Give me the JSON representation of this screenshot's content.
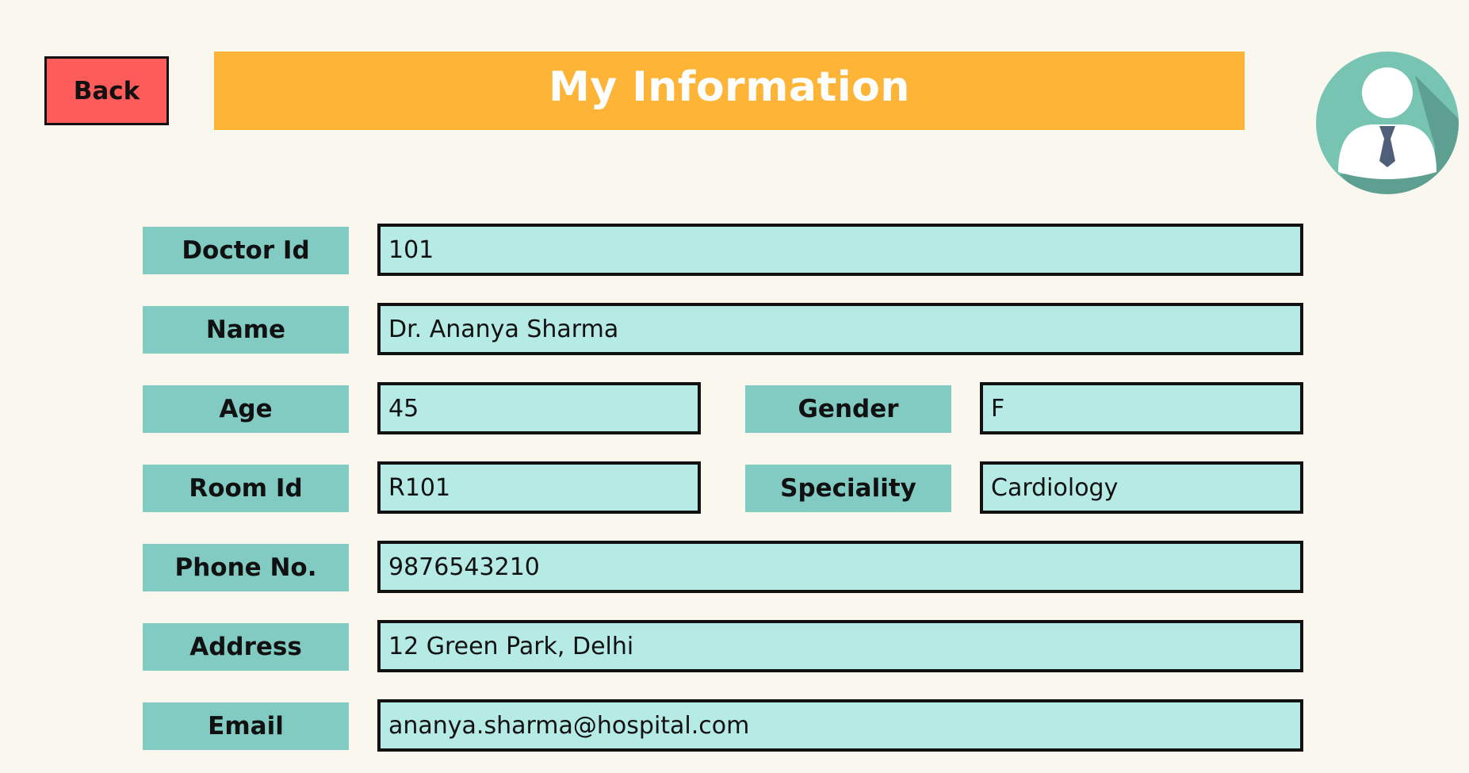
{
  "header": {
    "back_label": "Back",
    "title": "My Information"
  },
  "avatar": {
    "icon": "doctor-avatar-icon",
    "bg_color": "#76c4b1",
    "tie_color": "#4f5f79"
  },
  "form": {
    "doctor_id": {
      "label": "Doctor Id",
      "value": "101"
    },
    "name": {
      "label": "Name",
      "value": "Dr. Ananya Sharma"
    },
    "age": {
      "label": "Age",
      "value": "45"
    },
    "gender": {
      "label": "Gender",
      "value": "F"
    },
    "room_id": {
      "label": "Room Id",
      "value": "R101"
    },
    "speciality": {
      "label": "Speciality",
      "value": "Cardiology"
    },
    "phone": {
      "label": "Phone No.",
      "value": "9876543210"
    },
    "address": {
      "label": "Address",
      "value": "12 Green Park, Delhi"
    },
    "email": {
      "label": "Email",
      "value": "ananya.sharma@hospital.com"
    }
  },
  "colors": {
    "background": "#faf7ef",
    "title_bar": "#fdb437",
    "back_button": "#fd5c5b",
    "label_bg": "#81cbc3",
    "field_bg": "#b5eae5"
  }
}
